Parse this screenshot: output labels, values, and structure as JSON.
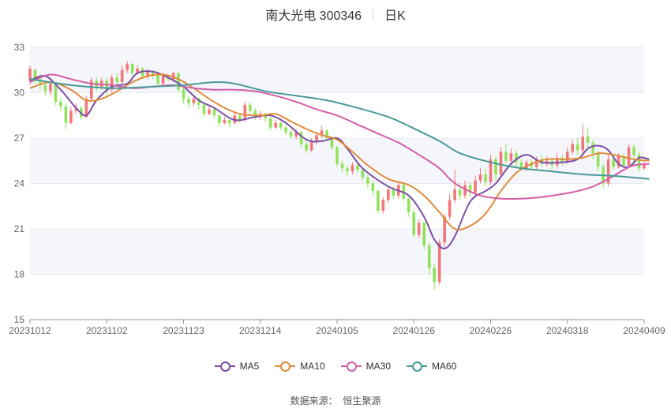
{
  "header": {
    "stock_name": "南大光电 300346",
    "period_label": "日K"
  },
  "source": {
    "label": "数据来源：",
    "provider": "恒生聚源"
  },
  "colors": {
    "up": "#f2767a",
    "down": "#8fe35a",
    "ma5": "#7b4fa6",
    "ma10": "#e08a3c",
    "ma30": "#d45fa8",
    "ma60": "#4a9a98",
    "grid": "#e8ebf2",
    "band": "#f4f6fb"
  },
  "chart_data": {
    "type": "candlestick",
    "y_ticks": [
      "15",
      "18",
      "21",
      "24",
      "27",
      "30",
      "33"
    ],
    "ylim": [
      15,
      33
    ],
    "x_ticks": [
      "20231012",
      "20231102",
      "20231123",
      "20231214",
      "20240105",
      "20240126",
      "20240226",
      "20240318",
      "20240409"
    ],
    "x_tick_index": [
      0,
      15,
      30,
      45,
      60,
      75,
      90,
      105,
      120
    ],
    "legend": [
      {
        "key": "ma5",
        "label": "MA5"
      },
      {
        "key": "ma10",
        "label": "MA10"
      },
      {
        "key": "ma30",
        "label": "MA30"
      },
      {
        "key": "ma60",
        "label": "MA60"
      }
    ],
    "candles": [
      [
        30.8,
        31.6,
        31.8,
        30.5
      ],
      [
        31.5,
        30.9,
        31.6,
        30.6
      ],
      [
        30.9,
        30.5,
        31.2,
        30.2
      ],
      [
        30.5,
        30.1,
        30.8,
        29.8
      ],
      [
        30.1,
        30.6,
        30.8,
        29.8
      ],
      [
        30.6,
        29.4,
        30.6,
        29.2
      ],
      [
        29.4,
        29.1,
        29.6,
        28.8
      ],
      [
        29.1,
        28.0,
        29.3,
        27.6
      ],
      [
        28.0,
        28.8,
        29.1,
        27.9
      ],
      [
        28.8,
        29.0,
        29.3,
        28.6
      ],
      [
        29.0,
        28.4,
        29.1,
        28.2
      ],
      [
        28.4,
        29.6,
        29.8,
        28.3
      ],
      [
        29.6,
        30.8,
        31.0,
        29.5
      ],
      [
        30.8,
        30.4,
        31.0,
        30.1
      ],
      [
        30.4,
        30.8,
        31.0,
        30.2
      ],
      [
        30.8,
        30.2,
        31.0,
        29.8
      ],
      [
        30.2,
        31.0,
        31.2,
        30.0
      ],
      [
        31.0,
        30.7,
        31.3,
        30.5
      ],
      [
        30.7,
        31.5,
        31.8,
        30.6
      ],
      [
        31.5,
        31.9,
        32.1,
        31.3
      ],
      [
        31.9,
        31.3,
        32.0,
        31.1
      ],
      [
        31.3,
        31.6,
        31.8,
        31.2
      ],
      [
        31.6,
        31.1,
        31.7,
        30.9
      ],
      [
        31.1,
        31.4,
        31.6,
        30.9
      ],
      [
        31.4,
        31.2,
        31.5,
        30.9
      ],
      [
        31.2,
        30.6,
        31.4,
        30.5
      ],
      [
        30.6,
        31.1,
        31.3,
        30.5
      ],
      [
        31.1,
        30.9,
        31.2,
        30.7
      ],
      [
        30.9,
        31.3,
        31.4,
        30.7
      ],
      [
        31.3,
        30.2,
        31.3,
        30.0
      ],
      [
        30.2,
        29.6,
        30.4,
        29.3
      ],
      [
        29.6,
        29.3,
        29.8,
        29.0
      ],
      [
        29.3,
        29.6,
        29.8,
        29.1
      ],
      [
        29.6,
        29.2,
        29.7,
        28.9
      ],
      [
        29.2,
        28.6,
        29.3,
        28.4
      ],
      [
        28.6,
        28.9,
        29.1,
        28.5
      ],
      [
        28.9,
        28.5,
        29.0,
        28.3
      ],
      [
        28.5,
        28.0,
        28.6,
        27.8
      ],
      [
        28.0,
        28.2,
        28.4,
        27.9
      ],
      [
        28.2,
        28.0,
        28.3,
        27.7
      ],
      [
        28.0,
        28.5,
        28.7,
        27.9
      ],
      [
        28.5,
        28.2,
        28.6,
        28.0
      ],
      [
        28.2,
        29.2,
        29.4,
        28.1
      ],
      [
        29.2,
        28.8,
        29.4,
        28.5
      ],
      [
        28.8,
        28.4,
        29.0,
        28.2
      ],
      [
        28.4,
        28.6,
        28.8,
        28.2
      ],
      [
        28.6,
        28.3,
        28.7,
        28.1
      ],
      [
        28.3,
        27.7,
        28.4,
        27.5
      ],
      [
        27.7,
        28.0,
        28.2,
        27.6
      ],
      [
        28.0,
        27.7,
        28.1,
        27.5
      ],
      [
        27.7,
        27.4,
        27.9,
        27.2
      ],
      [
        27.4,
        27.1,
        27.6,
        26.9
      ],
      [
        27.1,
        27.4,
        27.6,
        26.9
      ],
      [
        27.4,
        26.6,
        27.5,
        26.4
      ],
      [
        26.6,
        26.2,
        26.8,
        26.0
      ],
      [
        26.2,
        26.8,
        27.0,
        26.1
      ],
      [
        26.8,
        27.2,
        27.4,
        26.6
      ],
      [
        27.2,
        27.5,
        27.8,
        27.0
      ],
      [
        27.5,
        27.0,
        27.6,
        26.8
      ],
      [
        27.0,
        26.4,
        27.1,
        26.2
      ],
      [
        26.4,
        25.3,
        26.5,
        25.1
      ],
      [
        25.3,
        25.0,
        25.5,
        24.7
      ],
      [
        25.0,
        24.8,
        25.2,
        24.5
      ],
      [
        24.8,
        25.2,
        25.4,
        24.6
      ],
      [
        25.2,
        24.9,
        25.4,
        24.7
      ],
      [
        24.9,
        24.4,
        25.0,
        24.2
      ],
      [
        24.4,
        24.0,
        24.6,
        23.7
      ],
      [
        24.0,
        23.5,
        24.2,
        23.2
      ],
      [
        23.5,
        22.2,
        23.6,
        22.0
      ],
      [
        22.2,
        22.9,
        23.1,
        22.0
      ],
      [
        22.9,
        23.6,
        23.8,
        22.7
      ],
      [
        23.6,
        23.2,
        23.8,
        23.0
      ],
      [
        23.2,
        23.9,
        24.1,
        23.0
      ],
      [
        23.9,
        23.0,
        24.0,
        22.8
      ],
      [
        23.0,
        22.1,
        23.1,
        21.8
      ],
      [
        22.1,
        20.6,
        22.2,
        20.4
      ],
      [
        20.6,
        21.4,
        21.6,
        20.4
      ],
      [
        21.4,
        19.9,
        21.5,
        19.6
      ],
      [
        19.9,
        18.4,
        20.1,
        18.0
      ],
      [
        18.4,
        17.5,
        18.7,
        17.0
      ],
      [
        17.5,
        20.1,
        20.3,
        17.3
      ],
      [
        20.1,
        21.8,
        22.0,
        19.8
      ],
      [
        21.8,
        22.9,
        23.3,
        21.6
      ],
      [
        22.9,
        23.6,
        24.9,
        22.7
      ],
      [
        23.6,
        23.2,
        24.0,
        22.9
      ],
      [
        23.2,
        23.9,
        24.2,
        23.0
      ],
      [
        23.9,
        23.4,
        24.1,
        23.1
      ],
      [
        23.4,
        24.2,
        24.5,
        23.2
      ],
      [
        24.2,
        24.6,
        25.0,
        24.0
      ],
      [
        24.6,
        24.1,
        25.0,
        23.8
      ],
      [
        24.1,
        25.6,
        25.9,
        23.9
      ],
      [
        25.6,
        24.6,
        25.8,
        24.2
      ],
      [
        24.6,
        26.1,
        26.4,
        24.5
      ],
      [
        26.1,
        25.5,
        26.6,
        25.3
      ],
      [
        25.5,
        26.0,
        26.3,
        25.3
      ],
      [
        26.0,
        25.4,
        26.2,
        25.1
      ],
      [
        25.4,
        25.0,
        25.6,
        24.8
      ],
      [
        25.0,
        25.4,
        25.6,
        24.8
      ],
      [
        25.4,
        25.1,
        25.6,
        24.9
      ],
      [
        25.1,
        25.6,
        25.8,
        24.9
      ],
      [
        25.6,
        25.3,
        25.9,
        25.1
      ],
      [
        25.3,
        25.5,
        25.8,
        25.1
      ],
      [
        25.5,
        25.2,
        25.7,
        24.9
      ],
      [
        25.2,
        25.7,
        26.0,
        25.0
      ],
      [
        25.7,
        25.4,
        25.9,
        25.2
      ],
      [
        25.4,
        26.1,
        26.4,
        25.3
      ],
      [
        26.1,
        26.6,
        26.9,
        25.9
      ],
      [
        26.6,
        26.2,
        27.0,
        25.9
      ],
      [
        26.2,
        27.1,
        27.9,
        26.0
      ],
      [
        27.1,
        26.7,
        27.7,
        26.3
      ],
      [
        26.7,
        26.0,
        26.9,
        25.6
      ],
      [
        26.0,
        25.1,
        26.2,
        24.8
      ],
      [
        25.1,
        24.0,
        25.3,
        23.7
      ],
      [
        24.0,
        25.6,
        25.9,
        23.8
      ],
      [
        25.6,
        25.1,
        25.9,
        24.9
      ],
      [
        25.1,
        25.8,
        26.0,
        25.0
      ],
      [
        25.8,
        25.2,
        26.0,
        25.0
      ],
      [
        25.2,
        26.4,
        26.6,
        25.0
      ],
      [
        26.4,
        25.9,
        26.6,
        25.2
      ],
      [
        25.9,
        25.0,
        26.1,
        24.8
      ],
      [
        25.0,
        25.3,
        25.6,
        24.9
      ]
    ],
    "series": [
      {
        "name": "MA5",
        "key": "ma5",
        "anchors": [
          [
            0,
            30.8
          ],
          [
            3,
            31.1
          ],
          [
            6,
            30.2
          ],
          [
            9,
            29.0
          ],
          [
            11,
            28.5
          ],
          [
            13,
            29.5
          ],
          [
            16,
            30.4
          ],
          [
            19,
            30.6
          ],
          [
            21,
            31.3
          ],
          [
            24,
            31.4
          ],
          [
            27,
            31.0
          ],
          [
            30,
            30.4
          ],
          [
            33,
            29.5
          ],
          [
            36,
            29.0
          ],
          [
            40,
            28.2
          ],
          [
            44,
            28.4
          ],
          [
            47,
            28.5
          ],
          [
            50,
            28.0
          ],
          [
            54,
            26.9
          ],
          [
            57,
            26.8
          ],
          [
            60,
            27.0
          ],
          [
            62,
            26.3
          ],
          [
            65,
            25.0
          ],
          [
            70,
            23.8
          ],
          [
            74,
            23.2
          ],
          [
            77,
            21.8
          ],
          [
            79,
            20.3
          ],
          [
            81,
            19.7
          ],
          [
            83,
            20.5
          ],
          [
            86,
            22.8
          ],
          [
            89,
            23.5
          ],
          [
            91,
            24.0
          ],
          [
            94,
            25.3
          ],
          [
            97,
            25.9
          ],
          [
            100,
            25.4
          ],
          [
            104,
            25.4
          ],
          [
            107,
            25.6
          ],
          [
            109,
            26.3
          ],
          [
            111,
            26.5
          ],
          [
            113,
            26.2
          ],
          [
            115,
            25.3
          ],
          [
            117,
            25.1
          ],
          [
            119,
            25.7
          ],
          [
            121,
            25.6
          ]
        ]
      },
      {
        "name": "MA10",
        "key": "ma10",
        "anchors": [
          [
            0,
            30.3
          ],
          [
            4,
            30.7
          ],
          [
            8,
            30.2
          ],
          [
            11,
            29.5
          ],
          [
            14,
            29.6
          ],
          [
            17,
            30.1
          ],
          [
            20,
            30.7
          ],
          [
            23,
            31.1
          ],
          [
            26,
            31.2
          ],
          [
            29,
            30.9
          ],
          [
            32,
            30.3
          ],
          [
            35,
            29.6
          ],
          [
            38,
            29.0
          ],
          [
            41,
            28.6
          ],
          [
            45,
            28.5
          ],
          [
            48,
            28.6
          ],
          [
            51,
            28.1
          ],
          [
            54,
            27.6
          ],
          [
            57,
            27.2
          ],
          [
            60,
            26.9
          ],
          [
            63,
            26.1
          ],
          [
            66,
            25.2
          ],
          [
            70,
            24.3
          ],
          [
            74,
            23.9
          ],
          [
            77,
            23.2
          ],
          [
            80,
            22.1
          ],
          [
            83,
            21.0
          ],
          [
            86,
            21.2
          ],
          [
            89,
            22.0
          ],
          [
            92,
            23.5
          ],
          [
            95,
            24.7
          ],
          [
            98,
            25.3
          ],
          [
            101,
            25.6
          ],
          [
            105,
            25.6
          ],
          [
            108,
            25.7
          ],
          [
            111,
            26.0
          ],
          [
            114,
            25.9
          ],
          [
            118,
            25.6
          ],
          [
            121,
            25.5
          ]
        ]
      },
      {
        "name": "MA30",
        "key": "ma30",
        "anchors": [
          [
            0,
            30.7
          ],
          [
            4,
            31.2
          ],
          [
            8,
            30.9
          ],
          [
            12,
            30.6
          ],
          [
            16,
            30.5
          ],
          [
            20,
            30.3
          ],
          [
            24,
            30.4
          ],
          [
            28,
            30.5
          ],
          [
            32,
            30.3
          ],
          [
            36,
            30.2
          ],
          [
            40,
            30.2
          ],
          [
            44,
            30.1
          ],
          [
            48,
            29.8
          ],
          [
            52,
            29.4
          ],
          [
            56,
            28.9
          ],
          [
            60,
            28.5
          ],
          [
            64,
            27.9
          ],
          [
            68,
            27.3
          ],
          [
            72,
            26.7
          ],
          [
            76,
            25.9
          ],
          [
            80,
            25.0
          ],
          [
            82,
            24.3
          ],
          [
            84,
            23.8
          ],
          [
            88,
            23.2
          ],
          [
            92,
            23.0
          ],
          [
            96,
            23.0
          ],
          [
            100,
            23.1
          ],
          [
            104,
            23.3
          ],
          [
            107,
            23.5
          ],
          [
            110,
            23.8
          ],
          [
            113,
            24.3
          ],
          [
            116,
            24.9
          ],
          [
            118,
            25.2
          ],
          [
            121,
            25.3
          ]
        ]
      },
      {
        "name": "MA60",
        "key": "ma60",
        "anchors": [
          [
            0,
            30.9
          ],
          [
            8,
            30.5
          ],
          [
            16,
            30.3
          ],
          [
            24,
            30.4
          ],
          [
            30,
            30.5
          ],
          [
            36,
            30.7
          ],
          [
            40,
            30.6
          ],
          [
            46,
            30.1
          ],
          [
            52,
            29.8
          ],
          [
            58,
            29.5
          ],
          [
            64,
            29.0
          ],
          [
            70,
            28.4
          ],
          [
            74,
            27.8
          ],
          [
            80,
            26.8
          ],
          [
            84,
            26.0
          ],
          [
            90,
            25.4
          ],
          [
            96,
            25.0
          ],
          [
            102,
            24.8
          ],
          [
            108,
            24.6
          ],
          [
            114,
            24.5
          ],
          [
            121,
            24.3
          ]
        ]
      }
    ]
  }
}
